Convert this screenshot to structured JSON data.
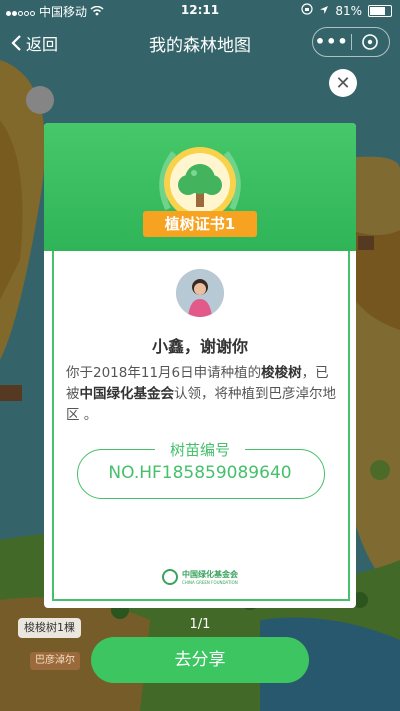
{
  "status_bar": {
    "carrier": "中国移动",
    "time": "12:11",
    "battery": "81%",
    "battery_level": 0.81
  },
  "nav": {
    "back_label": "返回",
    "title": "我的森林地图"
  },
  "certificate": {
    "badge_title": "植树证书1",
    "greeting": "小鑫，谢谢你",
    "message_part1": "你于2018年11月6日申请种植的",
    "tree_name": "梭梭树",
    "message_part2": "，已被",
    "foundation": "中国绿化基金会",
    "message_part3": "认领，将种植到巴彦淖尔地区 。",
    "serial_label": "树苗编号",
    "serial_number": "NO.HF185859089640",
    "footer_org": "中国绿化基金会",
    "footer_org_en": "CHINA GREEN FOUNDATION"
  },
  "pager": "1/1",
  "share_button": "去分享",
  "map": {
    "tree_tag": "梭梭树1棵",
    "place_sign": "巴彦淖尔"
  },
  "colors": {
    "brand_green": "#3cc561",
    "badge_orange": "#f7a322"
  }
}
